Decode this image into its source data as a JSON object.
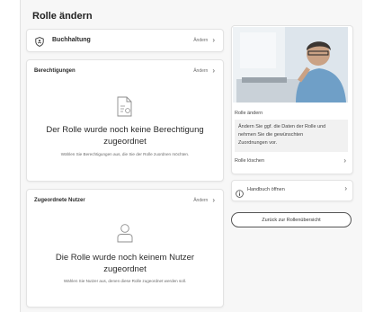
{
  "page": {
    "title": "Rolle ändern"
  },
  "role_card": {
    "name": "Buchhaltung",
    "action": "Ändern",
    "icon": "shield-icon"
  },
  "permissions": {
    "header": "Berechtigungen",
    "action": "Ändern",
    "empty_title_line1": "Der Rolle wurde noch keine Berechtigung",
    "empty_title_line2": "zugeordnet",
    "empty_subtitle": "Wählen Sie Berechtigungen aus, die Sie der Rolle zuordnen möchten.",
    "icon": "document-icon"
  },
  "users": {
    "header": "Zugeordnete Nutzer",
    "action": "Ändern",
    "empty_title_line1": "Die Rolle wurde noch keinem Nutzer",
    "empty_title_line2": "zugeordnet",
    "empty_subtitle": "Wählen Sie Nutzer aus, denen diese Rolle zugeordnet werden soll.",
    "icon": "user-icon"
  },
  "side": {
    "section_label": "Rolle ändern",
    "info_text_line1": "Ändern Sie ggf. die Daten der Rolle und",
    "info_text_line2": "nehmen Sie die gewünschten",
    "info_text_line3": "Zuordnungen vor.",
    "delete_label": "Rolle löschen",
    "handbook_label": "Handbuch öffnen",
    "handbook_icon": "info-icon",
    "back_button": "Zurück zur Rollenübersicht"
  },
  "colors": {
    "background": "#f7f7f7",
    "card": "#ffffff",
    "border": "#e3e3e3",
    "text": "#2b2b2b"
  }
}
